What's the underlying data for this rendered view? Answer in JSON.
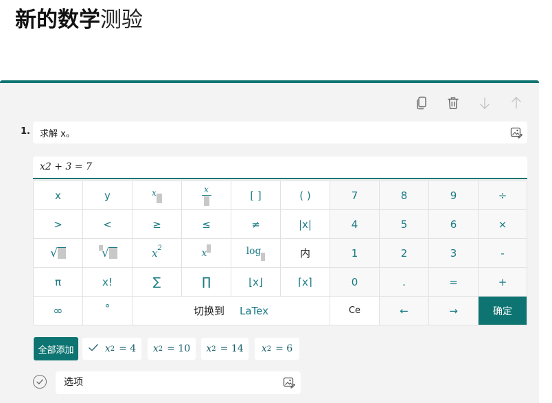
{
  "header": {
    "title_bold": "新的数学",
    "title_normal": "测验"
  },
  "toolbar": {
    "icons": [
      "copy-icon",
      "delete-icon",
      "move-down-icon",
      "move-up-icon"
    ]
  },
  "question": {
    "number": "1.",
    "text": "求解 x。",
    "image_icon": "insert-image-icon"
  },
  "equation": {
    "value": "x2 + 3 = 7"
  },
  "keypad": {
    "row1": {
      "x": "x",
      "y": "y",
      "subscript": "x",
      "fraction": "x",
      "brackets": "[ ]",
      "parens": "( )",
      "n7": "7",
      "n8": "8",
      "n9": "9",
      "divide": "÷"
    },
    "row2": {
      "gt": ">",
      "lt": "<",
      "ge": "≥",
      "le": "≤",
      "ne": "≠",
      "abs": "|x|",
      "n4": "4",
      "n5": "5",
      "n6": "6",
      "times": "×"
    },
    "row3": {
      "sqrt": "√",
      "nthroot": "√",
      "square_base": "x",
      "square_exp": "2",
      "power": "x",
      "log": "log",
      "inner": "内",
      "n1": "1",
      "n2": "2",
      "n3": "3",
      "minus": "-"
    },
    "row4": {
      "pi": "π",
      "factorial": "x!",
      "sum": "∑",
      "product": "∏",
      "floor": "⌊x⌋",
      "ceil": "⌈x⌉",
      "n0": "0",
      "dot": ".",
      "equals": "=",
      "plus": "+"
    },
    "row5": {
      "infinity": "∞",
      "degree": "°",
      "switch_label": "切换到",
      "switch_target": "LaTex",
      "clear": "Ce",
      "left": "←",
      "right": "→",
      "confirm": "确定"
    }
  },
  "answers": {
    "add_all": "全部添加",
    "chips": [
      {
        "var": "x",
        "sub": "2",
        "value": "= 4",
        "checked": true
      },
      {
        "var": "x",
        "sub": "2",
        "value": "= 10"
      },
      {
        "var": "x",
        "sub": "2",
        "value": "= 14"
      },
      {
        "var": "x",
        "sub": "2",
        "value": "= 6"
      }
    ]
  },
  "option": {
    "text": "选项"
  },
  "colors": {
    "accent": "#0d7472",
    "key_text": "#1a7a85",
    "background": "#f3f3f3"
  }
}
